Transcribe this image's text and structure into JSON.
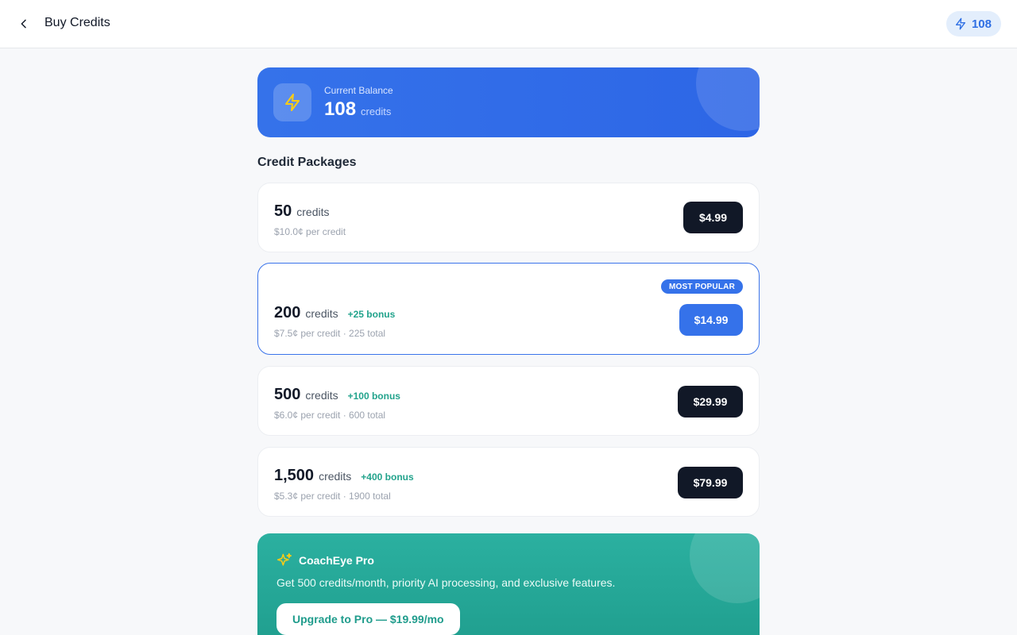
{
  "header": {
    "title": "Buy Credits",
    "balance_badge": "108"
  },
  "balance_card": {
    "label": "Current Balance",
    "value": "108",
    "unit": "credits"
  },
  "section_title": "Credit Packages",
  "packages": [
    {
      "amount": "50",
      "unit": "credits",
      "bonus": "",
      "sub": "$10.0¢ per credit",
      "price": "$4.99",
      "badge": ""
    },
    {
      "amount": "200",
      "unit": "credits",
      "bonus": "+25 bonus",
      "sub": "$7.5¢ per credit · 225 total",
      "price": "$14.99",
      "badge": "MOST POPULAR"
    },
    {
      "amount": "500",
      "unit": "credits",
      "bonus": "+100 bonus",
      "sub": "$6.0¢ per credit · 600 total",
      "price": "$29.99",
      "badge": ""
    },
    {
      "amount": "1,500",
      "unit": "credits",
      "bonus": "+400 bonus",
      "sub": "$5.3¢ per credit · 1900 total",
      "price": "$79.99",
      "badge": ""
    }
  ],
  "pro": {
    "title": "CoachEye Pro",
    "description": "Get 500 credits/month, priority AI processing, and exclusive features.",
    "button": "Upgrade to Pro — $19.99/mo"
  },
  "icons": {
    "back": "chevron-left-icon",
    "bolt": "lightning-bolt-icon",
    "sparkles": "sparkles-icon"
  },
  "colors": {
    "accent_blue": "#3572ea",
    "dark_button": "#111827",
    "bonus_green": "#22a38c",
    "pro_teal": "#26a898",
    "bolt_yellow": "#facc15"
  }
}
